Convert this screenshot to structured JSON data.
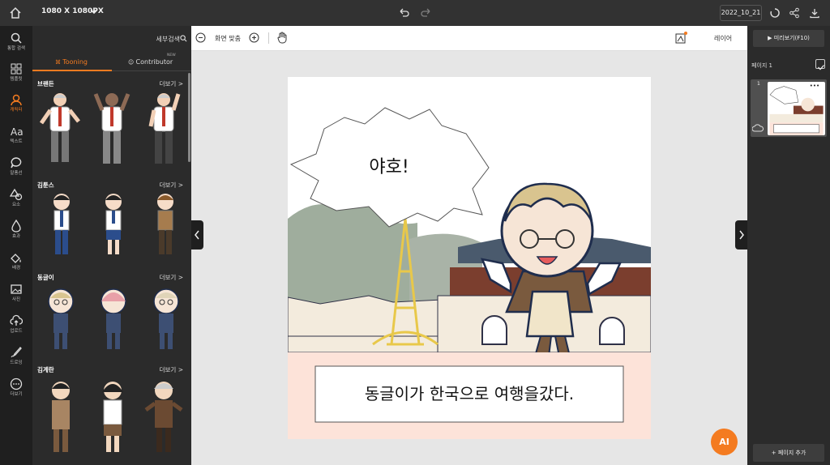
{
  "topbar": {
    "canvas_size": "1080 X 1080PX",
    "file_date": "2022_10_21"
  },
  "leftnav": [
    {
      "label": "통합 검색",
      "icon": "search-icon"
    },
    {
      "label": "템플릿",
      "icon": "grid-icon"
    },
    {
      "label": "캐릭터",
      "icon": "character-icon",
      "active": true
    },
    {
      "label": "텍스트",
      "icon": "text-icon"
    },
    {
      "label": "말풍선",
      "icon": "speech-bubble-icon"
    },
    {
      "label": "요소",
      "icon": "shapes-icon"
    },
    {
      "label": "효과",
      "icon": "effect-icon"
    },
    {
      "label": "배경",
      "icon": "background-icon"
    },
    {
      "label": "사진",
      "icon": "photo-icon"
    },
    {
      "label": "업로드",
      "icon": "upload-icon"
    },
    {
      "label": "드로잉",
      "icon": "drawing-icon"
    },
    {
      "label": "더보기",
      "icon": "more-icon"
    }
  ],
  "panel": {
    "search_label": "세부검색",
    "tabs": [
      {
        "label": "Tooning"
      },
      {
        "label": "Contributor",
        "badge": "NEW"
      }
    ],
    "more_label": "더보기 >",
    "sections": [
      {
        "title": "브랜든"
      },
      {
        "title": "김툰스"
      },
      {
        "title": "동글이"
      },
      {
        "title": "김계란"
      }
    ]
  },
  "toolbar": {
    "fit_label": "화면 맞춤",
    "layer_label": "레이어"
  },
  "canvas": {
    "speech_text": "야호!",
    "caption_text": "동글이가 한국으로 여행을갔다."
  },
  "ai_button": "AI",
  "rightpanel": {
    "preview_label": "미리보기(F10)",
    "page_label": "페이지 1",
    "page_number": "1",
    "add_page_label": "페이지 추가"
  },
  "colors": {
    "accent": "#f47b20",
    "dark": "#1f1f1f",
    "panel": "#2b2b2b",
    "caption_bg": "#fde3d9"
  }
}
